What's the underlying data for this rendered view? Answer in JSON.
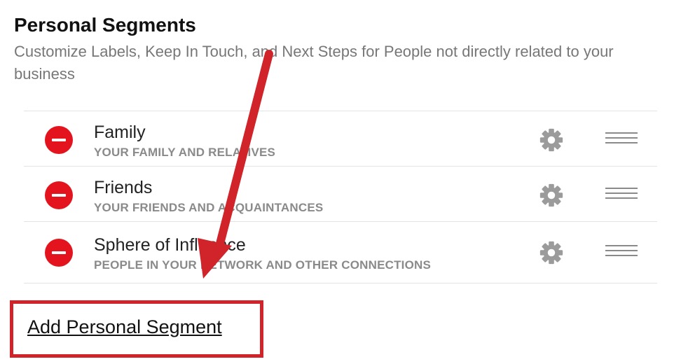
{
  "section": {
    "title": "Personal Segments",
    "description": "Customize Labels, Keep In Touch, and Next Steps for People not directly related to your business"
  },
  "segments": [
    {
      "name": "Family",
      "description": "YOUR FAMILY AND RELATIVES"
    },
    {
      "name": "Friends",
      "description": "YOUR FRIENDS AND ACQUAINTANCES"
    },
    {
      "name": "Sphere of Influence",
      "description": "PEOPLE IN YOUR NETWORK AND OTHER CONNECTIONS"
    }
  ],
  "actions": {
    "add_label": "Add Personal Segment"
  },
  "icons": {
    "remove": "minus-circle-icon",
    "settings": "gear-icon",
    "reorder": "drag-handle-icon"
  },
  "colors": {
    "remove_red": "#e4141e",
    "annotation_red": "#d0232a",
    "muted_text": "#8a8a8a"
  }
}
